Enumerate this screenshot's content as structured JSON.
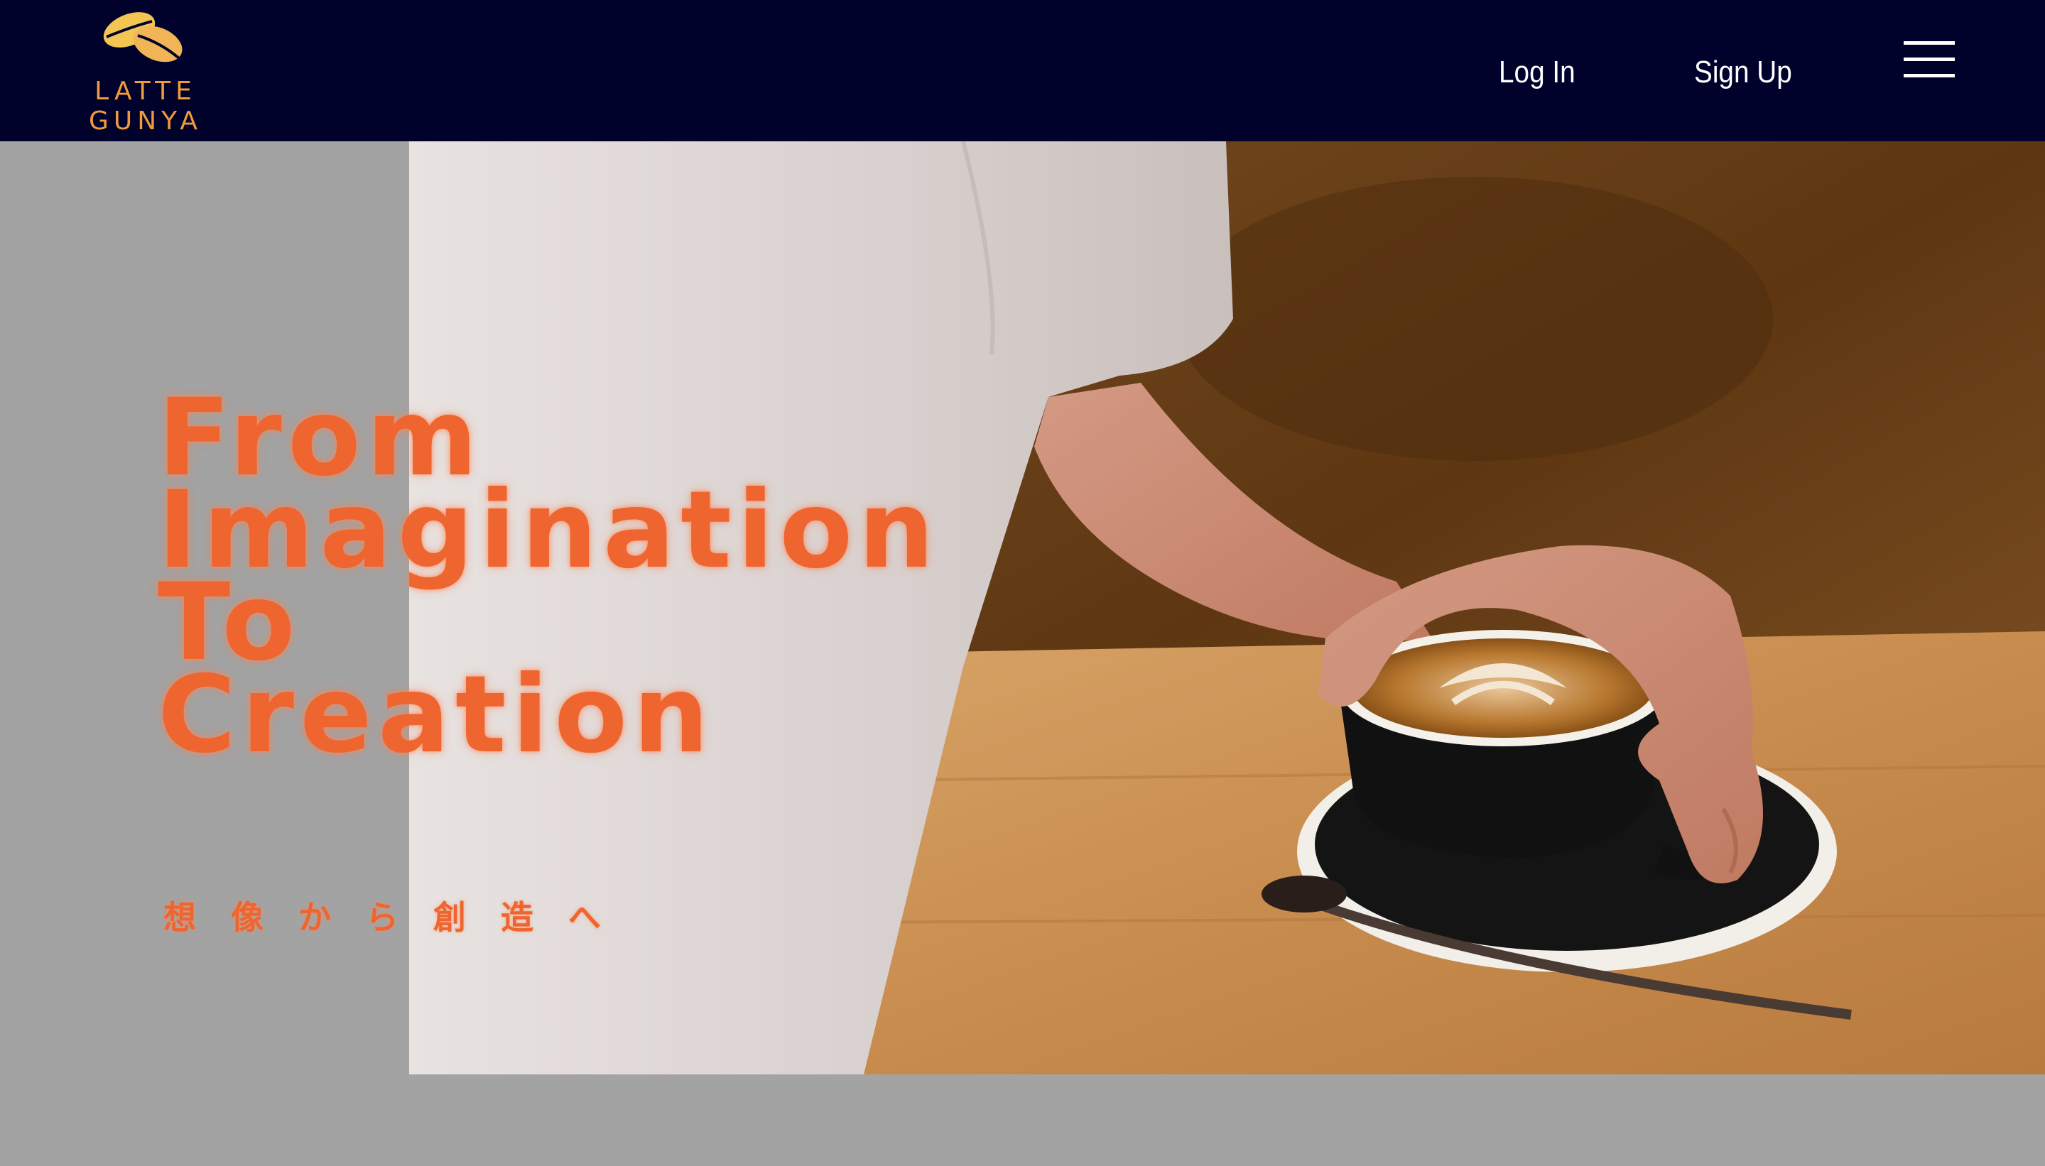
{
  "header": {
    "logo": {
      "line1": "LATTE",
      "line2": "GUNYA",
      "icon": "coffee-beans-icon"
    },
    "nav": {
      "login_label": "Log In",
      "signup_label": "Sign Up",
      "menu_icon": "hamburger-menu-icon"
    }
  },
  "hero": {
    "headline_lines": [
      "From",
      "Imagination",
      "To",
      "Creation"
    ],
    "tagline": "想像から創造へ",
    "image": "photo-man-in-white-tshirt-holding-latte-cup-on-wooden-table"
  },
  "colors": {
    "header_bg": "#00022c",
    "accent_orange": "#ef6530",
    "logo_gold": "#f09a3c",
    "page_bg": "#a3a3a3",
    "nav_text": "#ffffff"
  }
}
